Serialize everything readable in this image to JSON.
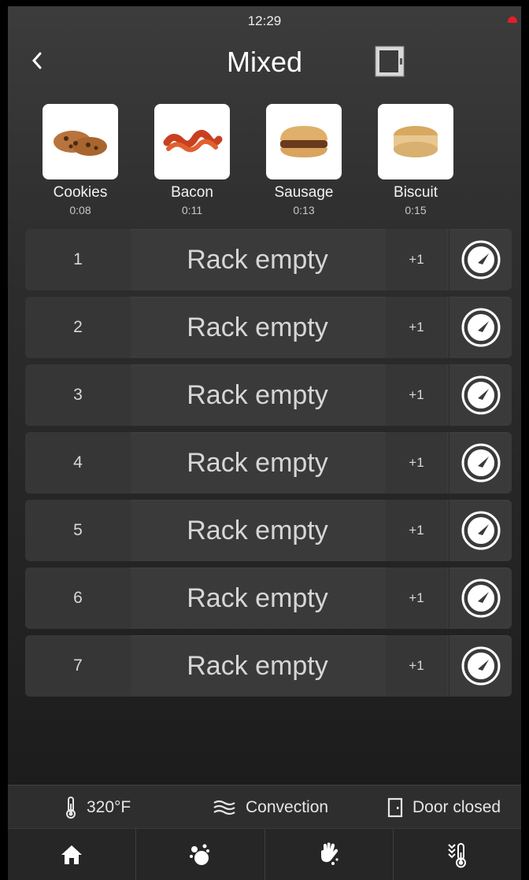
{
  "status_bar": {
    "time": "12:29",
    "alert_color": "#e0202a"
  },
  "header": {
    "title": "Mixed",
    "back_icon": "back-chevron-icon",
    "oven_icon": "oven-door-icon"
  },
  "foods": [
    {
      "name": "Cookies",
      "time": "0:08",
      "image": "cookies-image"
    },
    {
      "name": "Bacon",
      "time": "0:11",
      "image": "bacon-image"
    },
    {
      "name": "Sausage",
      "time": "0:13",
      "image": "sausage-image"
    },
    {
      "name": "Biscuit",
      "time": "0:15",
      "image": "biscuit-image"
    }
  ],
  "racks": [
    {
      "number": "1",
      "status": "Rack empty",
      "add": "+1"
    },
    {
      "number": "2",
      "status": "Rack empty",
      "add": "+1"
    },
    {
      "number": "3",
      "status": "Rack empty",
      "add": "+1"
    },
    {
      "number": "4",
      "status": "Rack empty",
      "add": "+1"
    },
    {
      "number": "5",
      "status": "Rack empty",
      "add": "+1"
    },
    {
      "number": "6",
      "status": "Rack empty",
      "add": "+1"
    },
    {
      "number": "7",
      "status": "Rack empty",
      "add": "+1"
    }
  ],
  "info_bar": {
    "temperature": "320°F",
    "mode": "Convection",
    "door": "Door closed"
  },
  "nav": [
    {
      "icon": "home-icon"
    },
    {
      "icon": "clean-icon"
    },
    {
      "icon": "hand-wash-icon"
    },
    {
      "icon": "cooldown-thermometer-icon"
    }
  ]
}
